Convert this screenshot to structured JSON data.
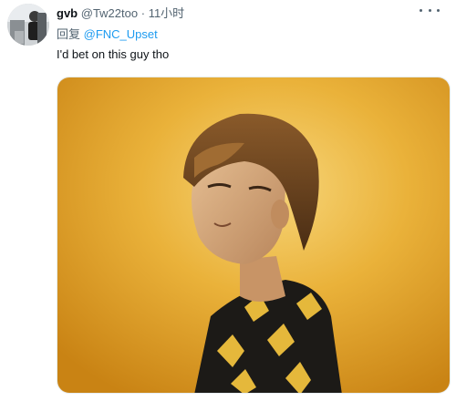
{
  "tweet": {
    "author": {
      "name": "gvb",
      "handle": "@Tw22too",
      "separator": "·",
      "time": "11小时"
    },
    "reply": {
      "prefix": "回复",
      "mention": "@FNC_Upset"
    },
    "text": "I'd bet on this guy tho",
    "icons": {
      "more": "more-horizontal-icon"
    },
    "colors": {
      "accent": "#1d9bf0",
      "secondary_text": "#536471",
      "primary_text": "#0f1419",
      "media_background": "#e8a72a"
    }
  }
}
